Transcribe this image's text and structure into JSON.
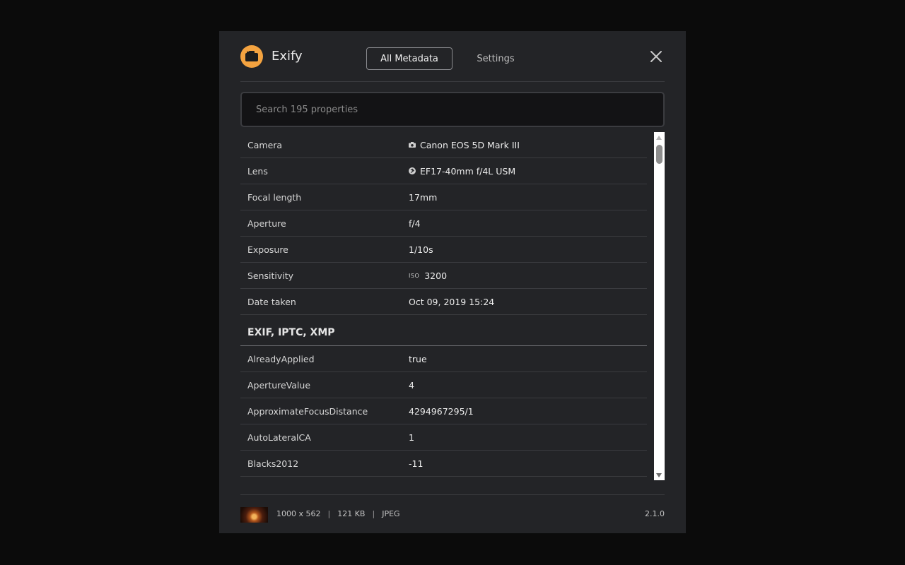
{
  "app": {
    "name": "Exify",
    "logo_icon": "camera-icon",
    "accent": "#f4a340"
  },
  "tabs": [
    {
      "label": "All Metadata",
      "active": true
    },
    {
      "label": "Settings",
      "active": false
    }
  ],
  "search": {
    "placeholder": "Search 195 properties",
    "value": ""
  },
  "summary": [
    {
      "key": "Camera",
      "value": "Canon EOS 5D Mark III",
      "icon": "camera-icon"
    },
    {
      "key": "Lens",
      "value": "EF17-40mm f/4L USM",
      "icon": "lens-icon"
    },
    {
      "key": "Focal length",
      "value": "17mm"
    },
    {
      "key": "Aperture",
      "value": "f/4"
    },
    {
      "key": "Exposure",
      "value": "1/10s"
    },
    {
      "key": "Sensitivity",
      "prefix": "ISO",
      "value": "3200"
    },
    {
      "key": "Date taken",
      "value": "Oct 09, 2019 15:24"
    }
  ],
  "section_title": "EXIF, IPTC, XMP",
  "properties": [
    {
      "key": "AlreadyApplied",
      "value": "true"
    },
    {
      "key": "ApertureValue",
      "value": "4"
    },
    {
      "key": "ApproximateFocusDistance",
      "value": "4294967295/1"
    },
    {
      "key": "AutoLateralCA",
      "value": "1"
    },
    {
      "key": "Blacks2012",
      "value": "-11"
    }
  ],
  "footer": {
    "dimensions": "1000 x 562",
    "size": "121 KB",
    "format": "JPEG",
    "separator": "|",
    "version": "2.1.0"
  }
}
